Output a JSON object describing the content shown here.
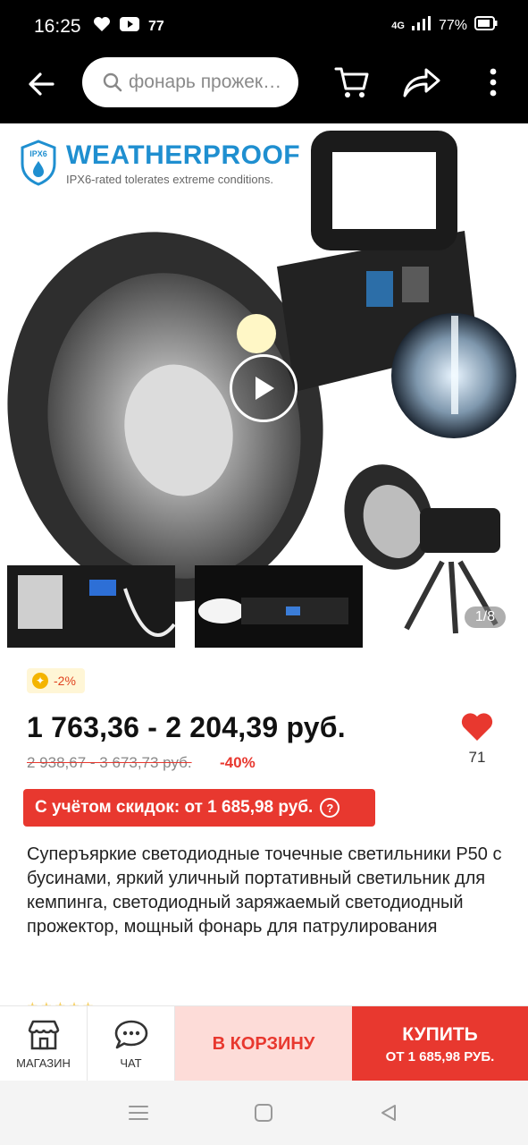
{
  "status": {
    "time": "16:25",
    "notif_count": "77",
    "network": "4G",
    "battery": "77%"
  },
  "header": {
    "search_placeholder": "фонарь прожек…"
  },
  "gallery": {
    "badge_title": "WEATHERPROOF",
    "badge_code": "IPX6",
    "badge_sub": "IPX6-rated tolerates extreme conditions.",
    "current_index": 1,
    "total": 8,
    "page_text": "1/8"
  },
  "product": {
    "discount_tag": "-2%",
    "price_range": "1 763,36 - 2 204,39 руб.",
    "old_price_range": "2 938,67 - 3 673,73 руб.",
    "discount_percent": "-40%",
    "favorites_count": "71",
    "coupon_text": "С учётом скидок: от 1 685,98 руб.",
    "coupon_info": "?",
    "title": "Суперъяркие светодиодные точечные светильники P50 с бусинами, яркий уличный портативный светильник для кемпинга, светодиодный заряжаемый светодиодный прожектор, мощный фонарь для патрулирования"
  },
  "bottom_bar": {
    "store_label": "МАГАЗИН",
    "chat_label": "ЧАТ",
    "cart_label": "В КОРЗИНУ",
    "buy_label": "КУПИТЬ",
    "buy_price": "ОТ 1 685,98 РУБ."
  },
  "colors": {
    "accent_red": "#e8382f",
    "cart_bg": "#fddcd8",
    "brand_blue": "#1f8fd0"
  }
}
